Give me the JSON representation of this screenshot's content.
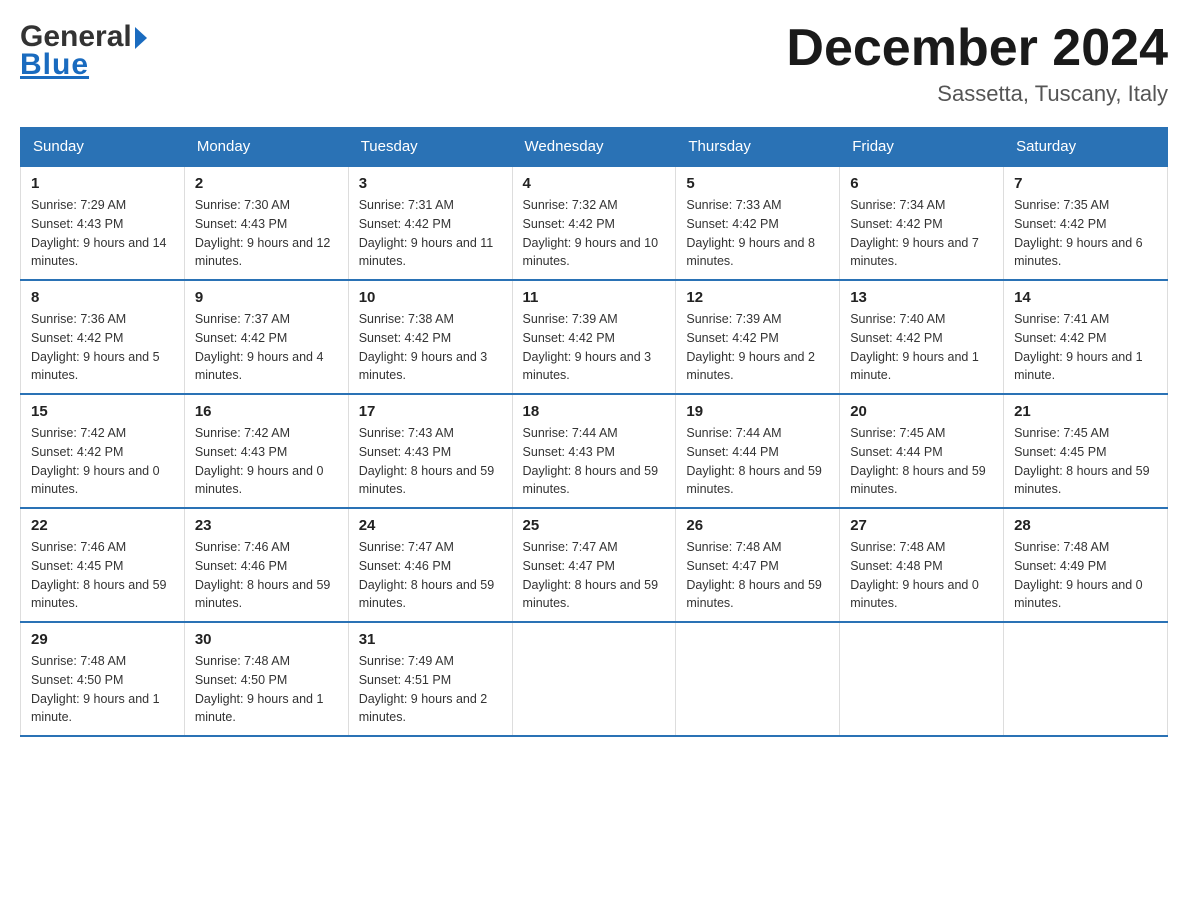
{
  "header": {
    "logo": {
      "general": "General",
      "blue": "Blue",
      "tagline": "Blue"
    },
    "title": "December 2024",
    "subtitle": "Sassetta, Tuscany, Italy"
  },
  "days_of_week": [
    "Sunday",
    "Monday",
    "Tuesday",
    "Wednesday",
    "Thursday",
    "Friday",
    "Saturday"
  ],
  "weeks": [
    [
      {
        "day": "1",
        "sunrise": "7:29 AM",
        "sunset": "4:43 PM",
        "daylight": "9 hours and 14 minutes."
      },
      {
        "day": "2",
        "sunrise": "7:30 AM",
        "sunset": "4:43 PM",
        "daylight": "9 hours and 12 minutes."
      },
      {
        "day": "3",
        "sunrise": "7:31 AM",
        "sunset": "4:42 PM",
        "daylight": "9 hours and 11 minutes."
      },
      {
        "day": "4",
        "sunrise": "7:32 AM",
        "sunset": "4:42 PM",
        "daylight": "9 hours and 10 minutes."
      },
      {
        "day": "5",
        "sunrise": "7:33 AM",
        "sunset": "4:42 PM",
        "daylight": "9 hours and 8 minutes."
      },
      {
        "day": "6",
        "sunrise": "7:34 AM",
        "sunset": "4:42 PM",
        "daylight": "9 hours and 7 minutes."
      },
      {
        "day": "7",
        "sunrise": "7:35 AM",
        "sunset": "4:42 PM",
        "daylight": "9 hours and 6 minutes."
      }
    ],
    [
      {
        "day": "8",
        "sunrise": "7:36 AM",
        "sunset": "4:42 PM",
        "daylight": "9 hours and 5 minutes."
      },
      {
        "day": "9",
        "sunrise": "7:37 AM",
        "sunset": "4:42 PM",
        "daylight": "9 hours and 4 minutes."
      },
      {
        "day": "10",
        "sunrise": "7:38 AM",
        "sunset": "4:42 PM",
        "daylight": "9 hours and 3 minutes."
      },
      {
        "day": "11",
        "sunrise": "7:39 AM",
        "sunset": "4:42 PM",
        "daylight": "9 hours and 3 minutes."
      },
      {
        "day": "12",
        "sunrise": "7:39 AM",
        "sunset": "4:42 PM",
        "daylight": "9 hours and 2 minutes."
      },
      {
        "day": "13",
        "sunrise": "7:40 AM",
        "sunset": "4:42 PM",
        "daylight": "9 hours and 1 minute."
      },
      {
        "day": "14",
        "sunrise": "7:41 AM",
        "sunset": "4:42 PM",
        "daylight": "9 hours and 1 minute."
      }
    ],
    [
      {
        "day": "15",
        "sunrise": "7:42 AM",
        "sunset": "4:42 PM",
        "daylight": "9 hours and 0 minutes."
      },
      {
        "day": "16",
        "sunrise": "7:42 AM",
        "sunset": "4:43 PM",
        "daylight": "9 hours and 0 minutes."
      },
      {
        "day": "17",
        "sunrise": "7:43 AM",
        "sunset": "4:43 PM",
        "daylight": "8 hours and 59 minutes."
      },
      {
        "day": "18",
        "sunrise": "7:44 AM",
        "sunset": "4:43 PM",
        "daylight": "8 hours and 59 minutes."
      },
      {
        "day": "19",
        "sunrise": "7:44 AM",
        "sunset": "4:44 PM",
        "daylight": "8 hours and 59 minutes."
      },
      {
        "day": "20",
        "sunrise": "7:45 AM",
        "sunset": "4:44 PM",
        "daylight": "8 hours and 59 minutes."
      },
      {
        "day": "21",
        "sunrise": "7:45 AM",
        "sunset": "4:45 PM",
        "daylight": "8 hours and 59 minutes."
      }
    ],
    [
      {
        "day": "22",
        "sunrise": "7:46 AM",
        "sunset": "4:45 PM",
        "daylight": "8 hours and 59 minutes."
      },
      {
        "day": "23",
        "sunrise": "7:46 AM",
        "sunset": "4:46 PM",
        "daylight": "8 hours and 59 minutes."
      },
      {
        "day": "24",
        "sunrise": "7:47 AM",
        "sunset": "4:46 PM",
        "daylight": "8 hours and 59 minutes."
      },
      {
        "day": "25",
        "sunrise": "7:47 AM",
        "sunset": "4:47 PM",
        "daylight": "8 hours and 59 minutes."
      },
      {
        "day": "26",
        "sunrise": "7:48 AM",
        "sunset": "4:47 PM",
        "daylight": "8 hours and 59 minutes."
      },
      {
        "day": "27",
        "sunrise": "7:48 AM",
        "sunset": "4:48 PM",
        "daylight": "9 hours and 0 minutes."
      },
      {
        "day": "28",
        "sunrise": "7:48 AM",
        "sunset": "4:49 PM",
        "daylight": "9 hours and 0 minutes."
      }
    ],
    [
      {
        "day": "29",
        "sunrise": "7:48 AM",
        "sunset": "4:50 PM",
        "daylight": "9 hours and 1 minute."
      },
      {
        "day": "30",
        "sunrise": "7:48 AM",
        "sunset": "4:50 PM",
        "daylight": "9 hours and 1 minute."
      },
      {
        "day": "31",
        "sunrise": "7:49 AM",
        "sunset": "4:51 PM",
        "daylight": "9 hours and 2 minutes."
      },
      null,
      null,
      null,
      null
    ]
  ],
  "labels": {
    "sunrise_prefix": "Sunrise: ",
    "sunset_prefix": "Sunset: ",
    "daylight_prefix": "Daylight: "
  }
}
